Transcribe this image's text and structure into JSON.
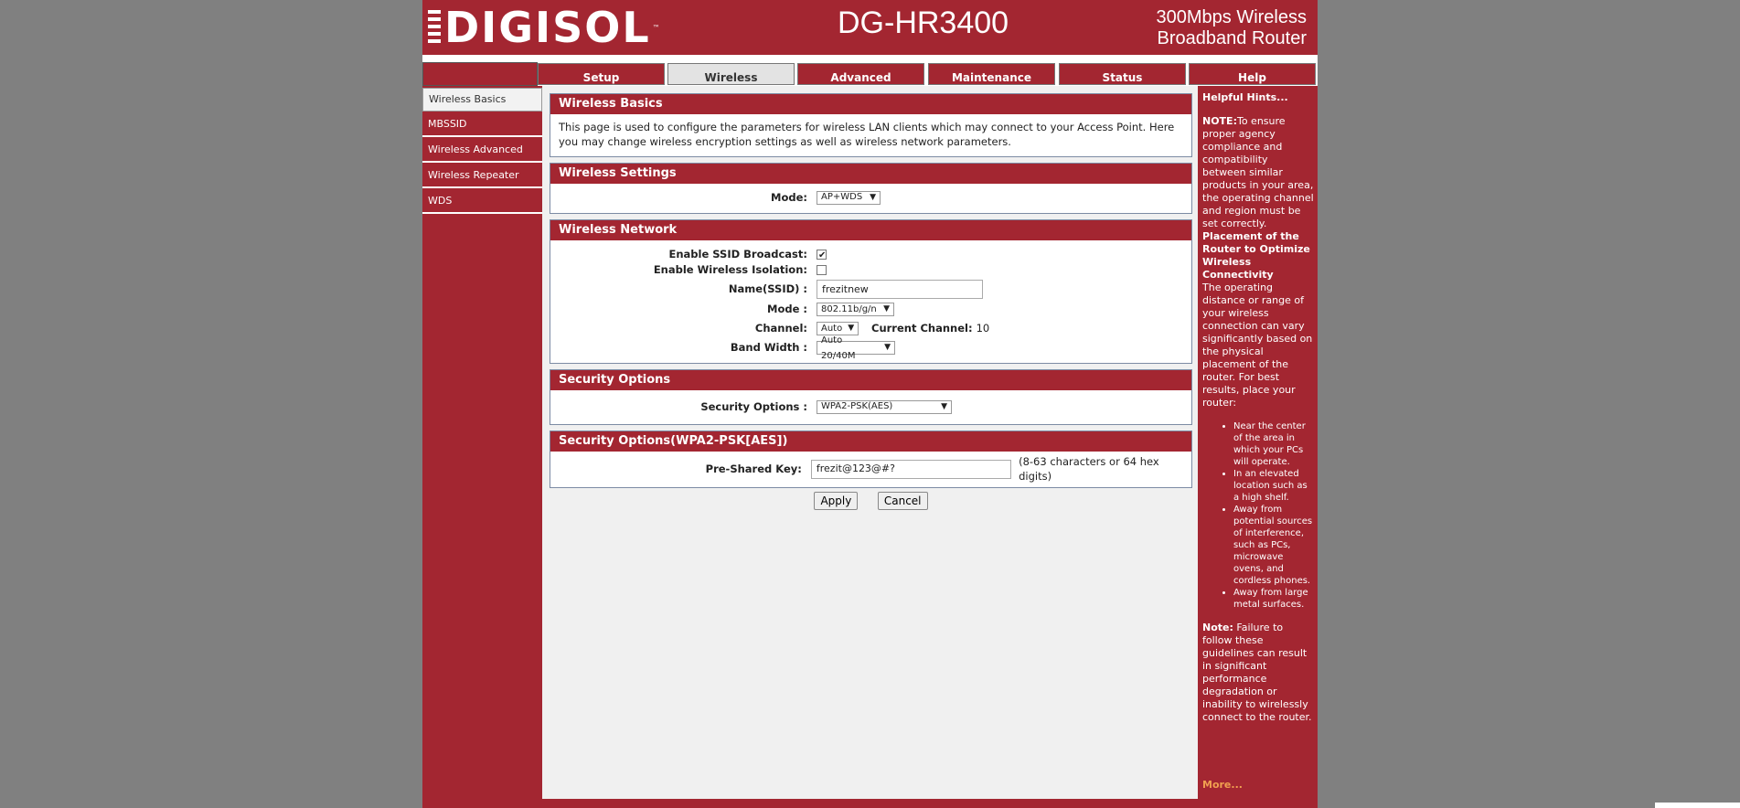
{
  "header": {
    "logo_text": "DIGISOL",
    "logo_tm": "™",
    "model": "DG-HR3400",
    "tagline_line1": "300Mbps Wireless",
    "tagline_line2": "Broadband Router"
  },
  "tabs": [
    {
      "label": "Setup"
    },
    {
      "label": "Wireless",
      "active": true
    },
    {
      "label": "Advanced"
    },
    {
      "label": "Maintenance"
    },
    {
      "label": "Status"
    },
    {
      "label": "Help"
    }
  ],
  "sidebar": {
    "items": [
      {
        "label": "Wireless Basics",
        "active": true
      },
      {
        "label": "MBSSID"
      },
      {
        "label": "Wireless Advanced"
      },
      {
        "label": "Wireless Repeater"
      },
      {
        "label": "WDS"
      }
    ]
  },
  "basics": {
    "title": "Wireless Basics",
    "description": "This page is used to configure the parameters for wireless LAN clients which may connect to your Access Point. Here you may change wireless encryption settings as well as wireless network parameters."
  },
  "settings": {
    "title": "Wireless Settings",
    "mode_label": "Mode:",
    "mode_value": "AP+WDS"
  },
  "network": {
    "title": "Wireless Network",
    "ssid_broadcast_label": "Enable SSID Broadcast:",
    "ssid_broadcast_checked": true,
    "isolation_label": "Enable Wireless Isolation:",
    "isolation_checked": false,
    "ssid_label": "Name(SSID) :",
    "ssid_value": "frezitnew",
    "mode_label": "Mode :",
    "mode_value": "802.11b/g/n",
    "channel_label": "Channel:",
    "channel_value": "Auto",
    "current_channel_label": "Current Channel:",
    "current_channel_value": "10",
    "bandwidth_label": "Band Width :",
    "bandwidth_value": "Auto 20/40M"
  },
  "security": {
    "title": "Security Options",
    "label": "Security Options :",
    "value": "WPA2-PSK(AES)"
  },
  "wpa": {
    "title": "Security Options(WPA2-PSK[AES])",
    "psk_label": "Pre-Shared Key:",
    "psk_value": "frezit@123@#?",
    "psk_hint": "(8-63 characters or 64 hex digits)"
  },
  "buttons": {
    "apply": "Apply",
    "cancel": "Cancel"
  },
  "hints": {
    "title": "Helpful Hints...",
    "note1_bold": "NOTE:",
    "note1_text": "To ensure proper agency compliance and compatibility between similar products in your area, the operating channel and region must be set correctly.",
    "placement_title": "Placement of the Router to Optimize Wireless Connectivity",
    "placement_text": "The operating distance or range of your wireless connection can vary significantly based on the physical placement of the router. For best results, place your router:",
    "list": [
      "Near the center of the area in which your PCs will operate.",
      "In an elevated location such as a high shelf.",
      "Away from potential sources of interference, such as PCs, microwave ovens, and cordless phones.",
      "Away from large metal surfaces."
    ],
    "note2_bold": "Note:",
    "note2_text": " Failure to follow these guidelines can result in significant performance degradation or inability to wirelessly connect to the router.",
    "more": "More..."
  },
  "colors": {
    "brand_red": "#a32631",
    "page_bg": "#f0f0f0",
    "outer_bg": "#808080"
  }
}
